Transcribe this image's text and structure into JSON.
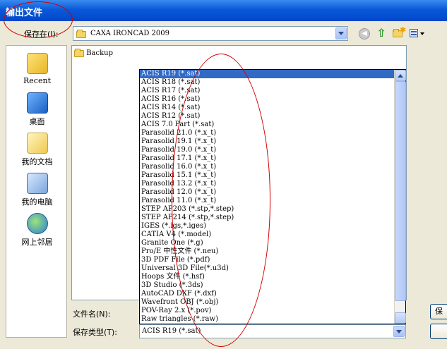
{
  "window": {
    "title": "输出文件"
  },
  "save_in": {
    "label": "保存在(I):",
    "value": "CAXA IRONCAD 2009"
  },
  "places": [
    {
      "label": "Recent",
      "icon": "recent-folder-icon"
    },
    {
      "label": "桌面",
      "icon": "desktop-icon"
    },
    {
      "label": "我的文档",
      "icon": "my-documents-icon"
    },
    {
      "label": "我的电脑",
      "icon": "my-computer-icon"
    },
    {
      "label": "网上邻居",
      "icon": "network-places-icon"
    }
  ],
  "file_list": [
    {
      "name": "Backup",
      "icon": "folder-icon"
    }
  ],
  "file_name": {
    "label": "文件名(N):",
    "value": ""
  },
  "file_type": {
    "label": "保存类型(T):",
    "value": "ACIS R19 (*.sat)",
    "options": [
      "ACIS R19 (*.sat)",
      "ACIS R18 (*.sat)",
      "ACIS R17 (*.sat)",
      "ACIS R16 (*.sat)",
      "ACIS R14 (*.sat)",
      "ACIS R12 (*.sat)",
      "ACIS 7.0 Part (*.sat)",
      "Parasolid 21.0 (*.x_t)",
      "Parasolid 19.1 (*.x_t)",
      "Parasolid 19.0 (*.x_t)",
      "Parasolid 17.1 (*.x_t)",
      "Parasolid 16.0 (*.x_t)",
      "Parasolid 15.1 (*.x_t)",
      "Parasolid 13.2 (*.x_t)",
      "Parasolid 12.0 (*.x_t)",
      "Parasolid 11.0 (*.x_t)",
      "STEP AP203 (*.stp,*.step)",
      "STEP AP214 (*.stp,*.step)",
      "IGES (*.igs,*.iges)",
      "CATIA V4 (*.model)",
      "Granite One (*.g)",
      "Pro/E 中性文件 (*.neu)",
      "3D PDF File (*.pdf)",
      "Universal 3D File(*.u3d)",
      "Hoops 文件 (*.hsf)",
      "3D Studio (*.3ds)",
      "AutoCAD DXF (*.dxf)",
      "Wavefront OBJ (*.obj)",
      "POV-Ray 2.x (*.pov)",
      "Raw triangles (*.raw)"
    ]
  },
  "buttons": {
    "save": "保"
  },
  "colors": {
    "selection": "#316ac5",
    "annotation": "#d00000",
    "titlebar": "#0a58d8"
  }
}
